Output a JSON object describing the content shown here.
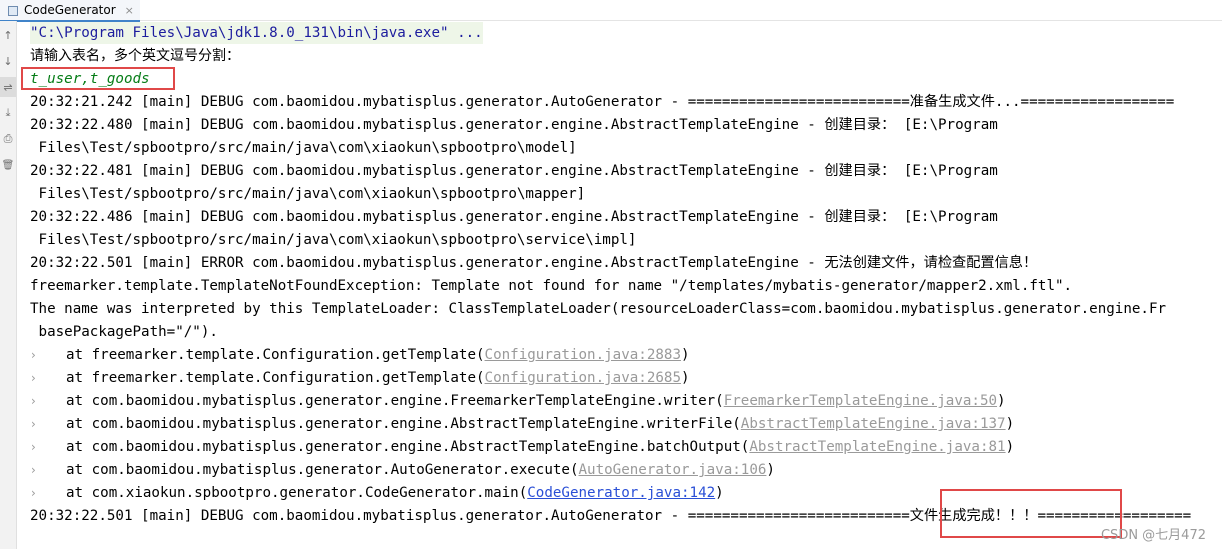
{
  "tab": {
    "title": "CodeGenerator",
    "close": "×"
  },
  "gutter_icons": [
    "arrow-up-icon",
    "arrow-down-icon",
    "soft-wrap-icon",
    "scroll-to-end-icon",
    "print-icon",
    "trash-icon"
  ],
  "gutter_glyphs": [
    "↑",
    "↓",
    "⇌",
    "⤓",
    "⎙",
    "🗑"
  ],
  "console": {
    "command": "\"C:\\Program Files\\Java\\jdk1.8.0_131\\bin\\java.exe\" ...",
    "prompt": "请输入表名，多个英文逗号分割：",
    "user_input": "t_user,t_goods",
    "log1": "20:32:21.242 [main] DEBUG com.baomidou.mybatisplus.generator.AutoGenerator - ==========================准备生成文件...==================",
    "log2a": "20:32:22.480 [main] DEBUG com.baomidou.mybatisplus.generator.engine.AbstractTemplateEngine - 创建目录： [E:\\Program",
    "log2b": " Files\\Test/spbootpro/src/main/java\\com\\xiaokun\\spbootpro\\model]",
    "log3a": "20:32:22.481 [main] DEBUG com.baomidou.mybatisplus.generator.engine.AbstractTemplateEngine - 创建目录： [E:\\Program",
    "log3b": " Files\\Test/spbootpro/src/main/java\\com\\xiaokun\\spbootpro\\mapper]",
    "log4a": "20:32:22.486 [main] DEBUG com.baomidou.mybatisplus.generator.engine.AbstractTemplateEngine - 创建目录： [E:\\Program",
    "log4b": " Files\\Test/spbootpro/src/main/java\\com\\xiaokun\\spbootpro\\service\\impl]",
    "log5": "20:32:22.501 [main] ERROR com.baomidou.mybatisplus.generator.engine.AbstractTemplateEngine - 无法创建文件，请检查配置信息！",
    "exc1": "freemarker.template.TemplateNotFoundException: Template not found for name \"/templates/mybatis-generator/mapper2.xml.ftl\".",
    "exc2": "The name was interpreted by this TemplateLoader: ClassTemplateLoader(resourceLoaderClass=com.baomidou.mybatisplus.generator.engine.Fr",
    "exc3": " basePackagePath=\"/\").",
    "fold_glyph": "›",
    "stack": [
      {
        "prefix": "at freemarker.template.Configuration.getTemplate(",
        "link": "Configuration.java:2883",
        "suffix": ")"
      },
      {
        "prefix": "at freemarker.template.Configuration.getTemplate(",
        "link": "Configuration.java:2685",
        "suffix": ")"
      },
      {
        "prefix": "at com.baomidou.mybatisplus.generator.engine.FreemarkerTemplateEngine.writer(",
        "link": "FreemarkerTemplateEngine.java:50",
        "suffix": ")"
      },
      {
        "prefix": "at com.baomidou.mybatisplus.generator.engine.AbstractTemplateEngine.writerFile(",
        "link": "AbstractTemplateEngine.java:137",
        "suffix": ")"
      },
      {
        "prefix": "at com.baomidou.mybatisplus.generator.engine.AbstractTemplateEngine.batchOutput(",
        "link": "AbstractTemplateEngine.java:81",
        "suffix": ")"
      },
      {
        "prefix": "at com.baomidou.mybatisplus.generator.AutoGenerator.execute(",
        "link": "AutoGenerator.java:106",
        "suffix": ")"
      },
      {
        "prefix": "at com.xiaokun.spbootpro.generator.CodeGenerator.main(",
        "link": "CodeGenerator.java:142",
        "suffix": ")"
      }
    ],
    "log6": "20:32:22.501 [main] DEBUG com.baomidou.mybatisplus.generator.AutoGenerator - ==========================文件生成完成！！！=================="
  },
  "watermark": "CSDN @七月472",
  "colors": {
    "highlight_box": "#e04848",
    "link": "#2a4fd6",
    "input_text": "#067d17"
  }
}
